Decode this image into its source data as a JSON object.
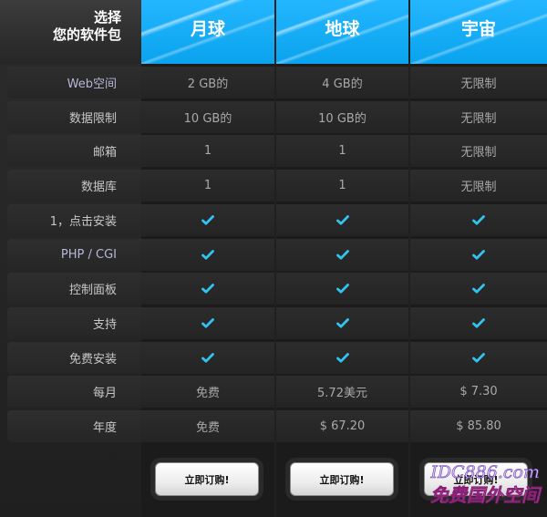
{
  "header": {
    "corner_line1": "选择",
    "corner_line2": "您的软件包",
    "plans": [
      "月球",
      "地球",
      "宇宙"
    ]
  },
  "rows": [
    {
      "label": "Web空间",
      "values": [
        "2 GB的",
        "4 GB的",
        "无限制"
      ]
    },
    {
      "label": "数据限制",
      "values": [
        "10 GB的",
        "10 GB的",
        "无限制"
      ]
    },
    {
      "label": "邮箱",
      "values": [
        "1",
        "1",
        "无限制"
      ]
    },
    {
      "label": "数据库",
      "values": [
        "1",
        "1",
        "无限制"
      ]
    },
    {
      "label": "1，点击安装",
      "values": [
        "check",
        "check",
        "check"
      ]
    },
    {
      "label": "PHP / CGI",
      "values": [
        "check",
        "check",
        "check"
      ]
    },
    {
      "label": "控制面板",
      "values": [
        "check",
        "check",
        "check"
      ]
    },
    {
      "label": "支持",
      "values": [
        "check",
        "check",
        "check"
      ]
    },
    {
      "label": "免费安装",
      "values": [
        "check",
        "check",
        "check"
      ]
    },
    {
      "label": "每月",
      "values": [
        "免费",
        "5.72美元",
        "$ 7.30"
      ]
    },
    {
      "label": "年度",
      "values": [
        "免费",
        "$ 67.20",
        "$ 85.80"
      ]
    }
  ],
  "buttons": [
    "立即订购!",
    "立即订购!",
    "立即订购!"
  ],
  "watermark": {
    "line1": "IDC886.com",
    "line2": "免费国外空间"
  },
  "colors": {
    "accent": "#0aa3ee",
    "check": "#33c3f0"
  },
  "icons": {
    "check": "check-icon"
  }
}
